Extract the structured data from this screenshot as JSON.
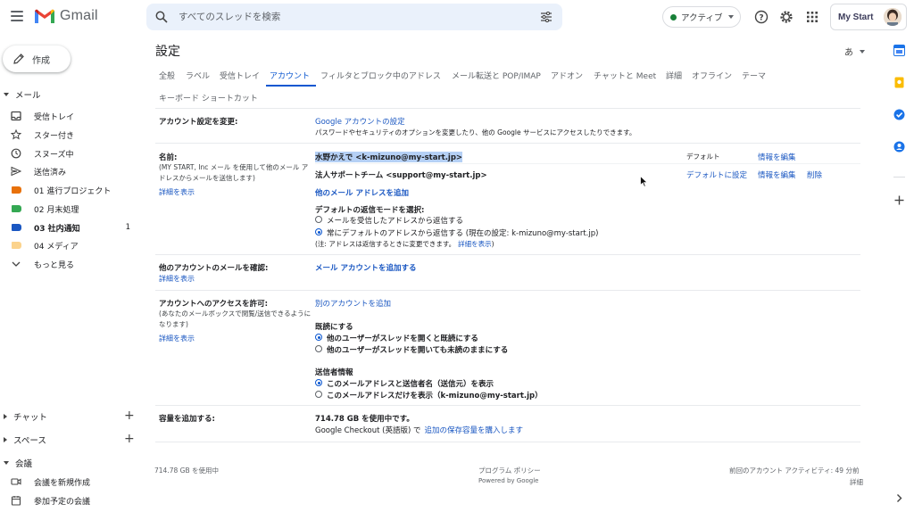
{
  "header": {
    "app_name": "Gmail",
    "search_placeholder": "すべてのスレッドを検索",
    "status_label": "アクティブ",
    "brand_label": "My Start"
  },
  "nav": {
    "compose": "作成",
    "mail_section": "メール",
    "items": [
      {
        "label": "受信トレイ",
        "icon": "inbox-icon"
      },
      {
        "label": "スター付き",
        "icon": "star-icon"
      },
      {
        "label": "スヌーズ中",
        "icon": "clock-icon"
      },
      {
        "label": "送信済み",
        "icon": "send-icon"
      },
      {
        "label": "01 進行プロジェクト",
        "icon": "label-icon",
        "color": "#e8710a"
      },
      {
        "label": "02 月末処理",
        "icon": "label-icon",
        "color": "#34a853"
      },
      {
        "label": "03 社内通知",
        "icon": "label-icon",
        "color": "#1a57c2",
        "count": "1"
      },
      {
        "label": "04 メディア",
        "icon": "label-icon",
        "color": "#fbd38d"
      },
      {
        "label": "もっと見る",
        "icon": "chevron-down-icon"
      }
    ],
    "chat": "チャット",
    "spaces": "スペース",
    "meetings": "会議",
    "new_meeting": "会議を新規作成",
    "upcoming": "参加予定の会議"
  },
  "settings": {
    "title": "設定",
    "lang": "あ",
    "tabs": [
      "全般",
      "ラベル",
      "受信トレイ",
      "アカウント",
      "フィルタとブロック中のアドレス",
      "メール転送と POP/IMAP",
      "アドオン",
      "チャットと Meet",
      "詳細",
      "オフライン",
      "テーマ"
    ],
    "tabs_row2": "キーボード ショートカット",
    "active_tab": "アカウント",
    "change_account": {
      "label": "アカウント設定を変更:",
      "link": "Google アカウントの設定",
      "desc": "パスワードやセキュリティのオプションを変更したり、他の Google サービスにアクセスしたりできます。"
    },
    "name": {
      "label": "名前:",
      "sub": "(MY START, Inc メール を使用して他のメール アドレスからメールを送信します)",
      "detail": "詳細を表示",
      "address1": "水野かえで <k-mizuno@my-start.jp>",
      "address2": "法人サポートチーム <support@my-start.jp>",
      "default": "デフォルト",
      "edit1": "情報を編集",
      "make_default": "デフォルトに設定",
      "edit2": "情報を編集",
      "delete": "削除",
      "add_other": "他のメール アドレスを追加",
      "reply_mode_label": "デフォルトの返信モードを選択:",
      "reply_opt1": "メールを受信したアドレスから返信する",
      "reply_opt2": "常にデフォルトのアドレスから返信する (現在の設定: k-mizuno@my-start.jp)",
      "note": "(注: アドレスは返信するときに変更できます。",
      "note_link": "詳細を表示",
      "note_end": ")"
    },
    "check_mail": {
      "label": "他のアカウントのメールを確認:",
      "detail": "詳細を表示",
      "link": "メール アカウントを追加する"
    },
    "grant": {
      "label": "アカウントへのアクセスを許可:",
      "sub": "(あなたのメールボックスで閲覧/送信できるようになります)",
      "detail": "詳細を表示",
      "link": "別のアカウントを追加",
      "read_label": "既読にする",
      "read_opt1": "他のユーザーがスレッドを開くと既読にする",
      "read_opt2": "他のユーザーがスレッドを開いても未読のままにする",
      "sender_label": "送信者情報",
      "sender_opt1": "このメールアドレスと送信者名（送信元）を表示",
      "sender_opt2": "このメールアドレスだけを表示（k-mizuno@my-start.jp）"
    },
    "storage": {
      "label": "容量を追加する:",
      "used": "714.78 GB を使用中です。",
      "checkout": "Google Checkout (英語版) で",
      "buy_link": "追加の保存容量を購入します"
    }
  },
  "footer": {
    "usage": "714.78 GB を使用中",
    "policy": "プログラム ポリシー",
    "powered": "Powered by Google",
    "last_activity": "前回のアカウント アクティビティ: 49 分前",
    "details": "詳細"
  }
}
